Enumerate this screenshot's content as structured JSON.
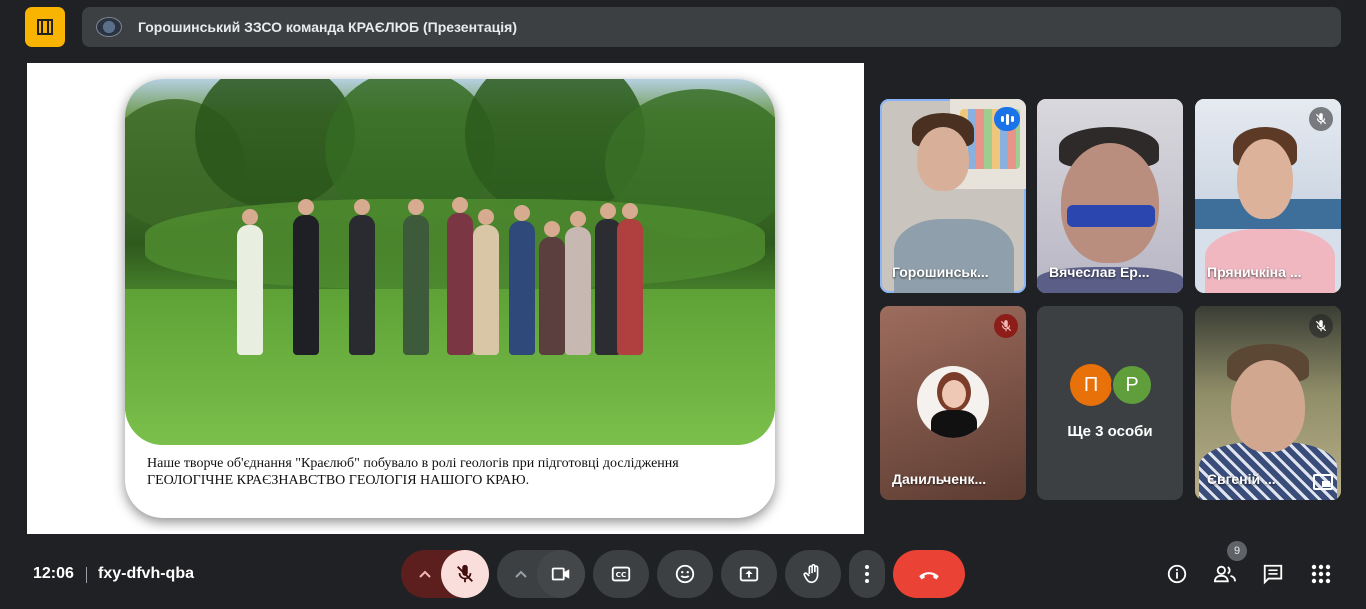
{
  "meeting": {
    "title": "Горошинський ЗЗСО команда КРАЄЛЮБ (Презентація)",
    "time": "12:06",
    "code": "fxy-dfvh-qba"
  },
  "slide": {
    "caption_line1": "Наше творче об'єднання \"Краєлюб\" побувало в ролі геологів при підготовці дослідження",
    "caption_line2": "ГЕОЛОГІЧНЕ КРАЄЗНАВСТВО ГЕОЛОГІЯ НАШОГО КРАЮ."
  },
  "participants": [
    {
      "name": "Горошинськ...",
      "state": "speaking"
    },
    {
      "name": "Вячеслав Ер...",
      "state": "normal"
    },
    {
      "name": "Пряничкіна ...",
      "state": "muted"
    },
    {
      "name": "Данильченк...",
      "state": "muted-red"
    },
    {
      "name": "Ще 3 особи",
      "initials": [
        "П",
        "Р"
      ],
      "state": "group"
    },
    {
      "name": "Євгеній ...",
      "state": "muted"
    }
  ],
  "people_count": "9",
  "colors": {
    "background": "#202124",
    "tile": "#3c4043",
    "end_call": "#ea4335",
    "mic_off": "#f9dedc",
    "accent_yellow": "#f9b401",
    "avatar_orange": "#e8710a",
    "avatar_green": "#34a853"
  },
  "icons": [
    "presentation-icon",
    "mic-off-icon",
    "camera-icon",
    "captions-icon",
    "emoji-icon",
    "present-icon",
    "raise-hand-icon",
    "more-icon",
    "end-call-icon",
    "info-icon",
    "people-icon",
    "chat-icon",
    "activities-icon"
  ]
}
